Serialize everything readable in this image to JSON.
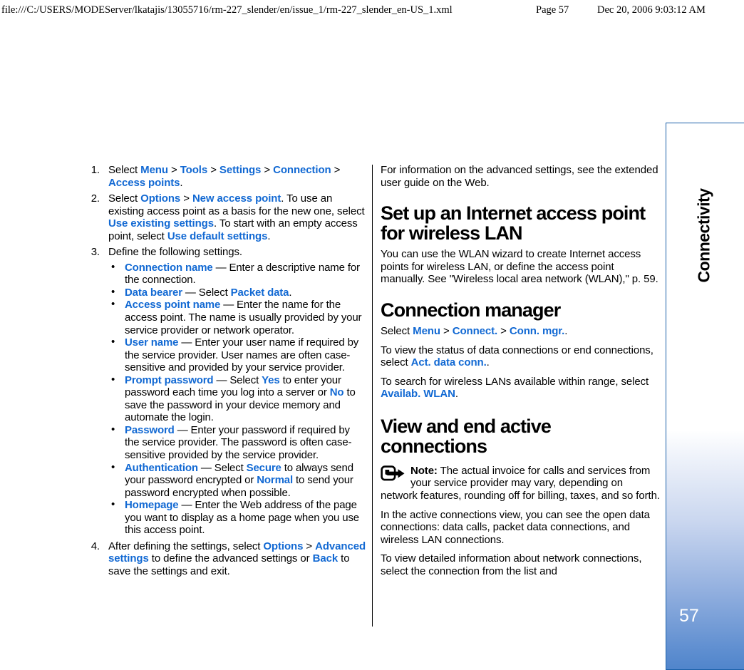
{
  "print_header": {
    "file_path": "file:///C:/USERS/MODEServer/lkatajis/13055716/rm-227_slender/en/issue_1/rm-227_slender_en-US_1.xml",
    "page_label": "Page 57",
    "timestamp": "Dec 20, 2006 9:03:12 AM"
  },
  "side_tab": {
    "chapter_label": "Connectivity",
    "page_number": "57",
    "border_color": "#1a5fa8",
    "gradient_end_color": "#1f66bd"
  },
  "accent_color": "#1269d3",
  "left_column": {
    "steps": [
      {
        "num": "1.",
        "runs": [
          {
            "t": "Select ",
            "s": "plain"
          },
          {
            "t": "Menu",
            "s": "kw"
          },
          {
            "t": " > ",
            "s": "plain"
          },
          {
            "t": "Tools",
            "s": "kw"
          },
          {
            "t": " > ",
            "s": "plain"
          },
          {
            "t": "Settings",
            "s": "kw"
          },
          {
            "t": " > ",
            "s": "plain"
          },
          {
            "t": "Connection",
            "s": "kw"
          },
          {
            "t": " > ",
            "s": "plain"
          },
          {
            "t": "Access points",
            "s": "kw"
          },
          {
            "t": ".",
            "s": "plain"
          }
        ]
      },
      {
        "num": "2.",
        "runs": [
          {
            "t": "Select ",
            "s": "plain"
          },
          {
            "t": "Options",
            "s": "kw"
          },
          {
            "t": " > ",
            "s": "plain"
          },
          {
            "t": "New access point",
            "s": "kw"
          },
          {
            "t": ". To use an existing access point as a basis for the new one, select ",
            "s": "plain"
          },
          {
            "t": "Use existing settings",
            "s": "kw"
          },
          {
            "t": ". To start with an empty access point, select ",
            "s": "plain"
          },
          {
            "t": "Use default settings",
            "s": "kw"
          },
          {
            "t": ".",
            "s": "plain"
          }
        ]
      },
      {
        "num": "3.",
        "runs": [
          {
            "t": "Define the following settings.",
            "s": "plain"
          }
        ]
      },
      {
        "num": "4.",
        "runs": [
          {
            "t": "After defining the settings, select ",
            "s": "plain"
          },
          {
            "t": "Options",
            "s": "kw"
          },
          {
            "t": " > ",
            "s": "plain"
          },
          {
            "t": "Advanced settings",
            "s": "kw"
          },
          {
            "t": " to define the advanced settings or ",
            "s": "plain"
          },
          {
            "t": "Back",
            "s": "kw"
          },
          {
            "t": " to save the settings and exit.",
            "s": "plain"
          }
        ]
      }
    ],
    "bullet_marker": "•",
    "bullets": [
      {
        "runs": [
          {
            "t": "Connection name",
            "s": "kw"
          },
          {
            "t": " — Enter a descriptive name for the connection.",
            "s": "plain"
          }
        ]
      },
      {
        "runs": [
          {
            "t": "Data bearer",
            "s": "kw"
          },
          {
            "t": " — Select ",
            "s": "plain"
          },
          {
            "t": "Packet data",
            "s": "kw"
          },
          {
            "t": ".",
            "s": "plain"
          }
        ]
      },
      {
        "runs": [
          {
            "t": "Access point name",
            "s": "kw"
          },
          {
            "t": " — Enter the name for the access point. The name is usually provided by your service provider or network operator.",
            "s": "plain"
          }
        ]
      },
      {
        "runs": [
          {
            "t": "User name",
            "s": "kw"
          },
          {
            "t": " — Enter your user name if required by the service provider. User names are often case-sensitive and provided by your service provider.",
            "s": "plain"
          }
        ]
      },
      {
        "runs": [
          {
            "t": "Prompt password",
            "s": "kw"
          },
          {
            "t": " — Select ",
            "s": "plain"
          },
          {
            "t": "Yes",
            "s": "kw"
          },
          {
            "t": " to enter your password each time you log into a server or ",
            "s": "plain"
          },
          {
            "t": "No",
            "s": "kw"
          },
          {
            "t": " to save the password in your device memory and automate the login.",
            "s": "plain"
          }
        ]
      },
      {
        "runs": [
          {
            "t": "Password",
            "s": "kw"
          },
          {
            "t": " — Enter your password if required by the service provider. The password is often case-sensitive provided by the service provider.",
            "s": "plain"
          }
        ]
      },
      {
        "runs": [
          {
            "t": "Authentication",
            "s": "kw"
          },
          {
            "t": " — Select ",
            "s": "plain"
          },
          {
            "t": "Secure",
            "s": "kw"
          },
          {
            "t": " to always send your password encrypted or ",
            "s": "plain"
          },
          {
            "t": "Normal",
            "s": "kw"
          },
          {
            "t": " to send your password encrypted when possible.",
            "s": "plain"
          }
        ]
      },
      {
        "runs": [
          {
            "t": "Homepage",
            "s": "kw"
          },
          {
            "t": " — Enter the Web address of the page you want to display as a home page when you use this access point.",
            "s": "plain"
          }
        ]
      }
    ]
  },
  "right_column": {
    "intro_paragraph": "For information on the advanced settings, see the extended user guide on the Web.",
    "heading_wlan": "Set up an Internet access point for wireless LAN",
    "wlan_paragraph": "You can use the WLAN wizard to create Internet access points for wireless LAN, or define the access point manually. See \"Wireless local area network (WLAN),\" p. 59.",
    "heading_connection_manager": "Connection manager",
    "conn_mgr_path": [
      {
        "t": "Select ",
        "s": "plain"
      },
      {
        "t": "Menu",
        "s": "kw"
      },
      {
        "t": " > ",
        "s": "plain"
      },
      {
        "t": "Connect.",
        "s": "kw"
      },
      {
        "t": " > ",
        "s": "plain"
      },
      {
        "t": "Conn. mgr.",
        "s": "kw"
      },
      {
        "t": ".",
        "s": "plain"
      }
    ],
    "status_paragraph": [
      {
        "t": "To view the status of data connections or end connections, select ",
        "s": "plain"
      },
      {
        "t": "Act. data conn.",
        "s": "kw"
      },
      {
        "t": ".",
        "s": "plain"
      }
    ],
    "search_paragraph": [
      {
        "t": "To search for wireless LANs available within range, select ",
        "s": "plain"
      },
      {
        "t": "Availab. WLAN",
        "s": "kw"
      },
      {
        "t": ".",
        "s": "plain"
      }
    ],
    "heading_view_end": "View and end active connections",
    "note": {
      "label": "Note:",
      "text": "The actual invoice for calls and services from your service provider may vary, depending on network features, rounding off for billing, taxes, and so forth."
    },
    "active_view_paragraph": "In the active connections view, you can see the open data connections: data calls, packet data connections, and wireless LAN connections.",
    "detail_paragraph": "To view detailed information about network connections, select the connection from the list and"
  }
}
